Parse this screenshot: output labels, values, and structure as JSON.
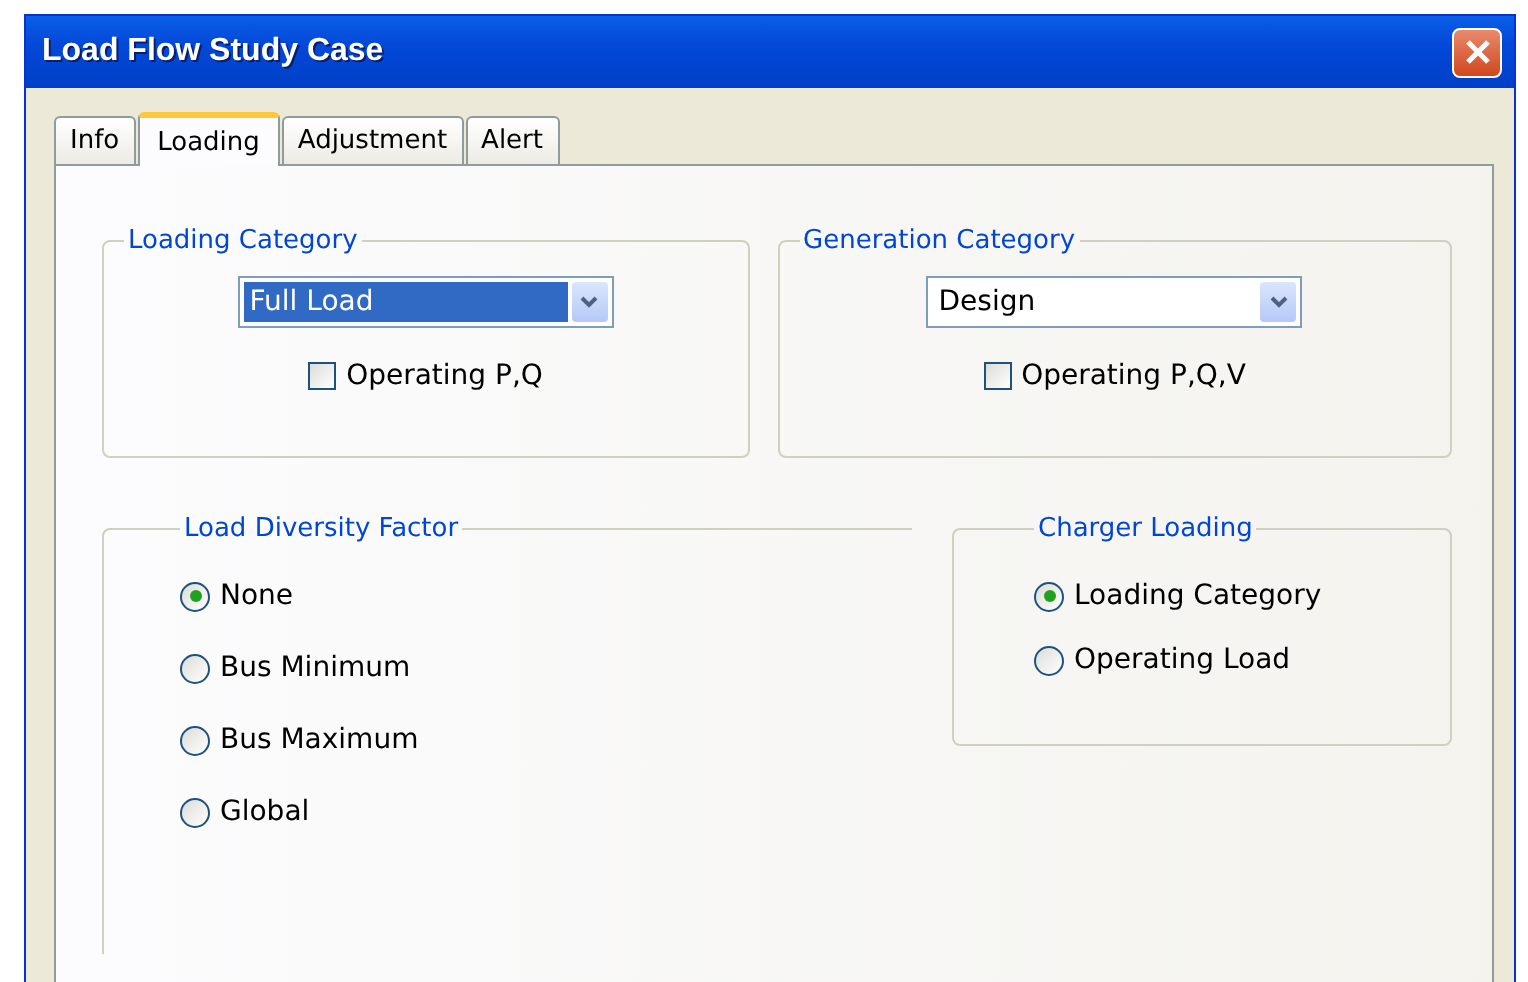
{
  "window": {
    "title": "Load Flow Study Case"
  },
  "tabs": [
    {
      "label": "Info",
      "selected": false
    },
    {
      "label": "Loading",
      "selected": true
    },
    {
      "label": "Adjustment",
      "selected": false
    },
    {
      "label": "Alert",
      "selected": false
    }
  ],
  "loading_category": {
    "title": "Loading Category",
    "dropdown": {
      "value": "Full Load",
      "focused": true
    },
    "checkbox": {
      "label": "Operating P,Q",
      "checked": false
    }
  },
  "generation_category": {
    "title": "Generation Category",
    "dropdown": {
      "value": "Design",
      "focused": false
    },
    "checkbox": {
      "label": "Operating P,Q,V",
      "checked": false
    }
  },
  "load_diversity_factor": {
    "title": "Load Diversity Factor",
    "options": [
      {
        "label": "None",
        "selected": true
      },
      {
        "label": "Bus Minimum",
        "selected": false
      },
      {
        "label": "Bus Maximum",
        "selected": false
      },
      {
        "label": "Global",
        "selected": false
      }
    ]
  },
  "charger_loading": {
    "title": "Charger Loading",
    "options": [
      {
        "label": "Loading Category",
        "selected": true
      },
      {
        "label": "Operating Load",
        "selected": false
      }
    ]
  }
}
